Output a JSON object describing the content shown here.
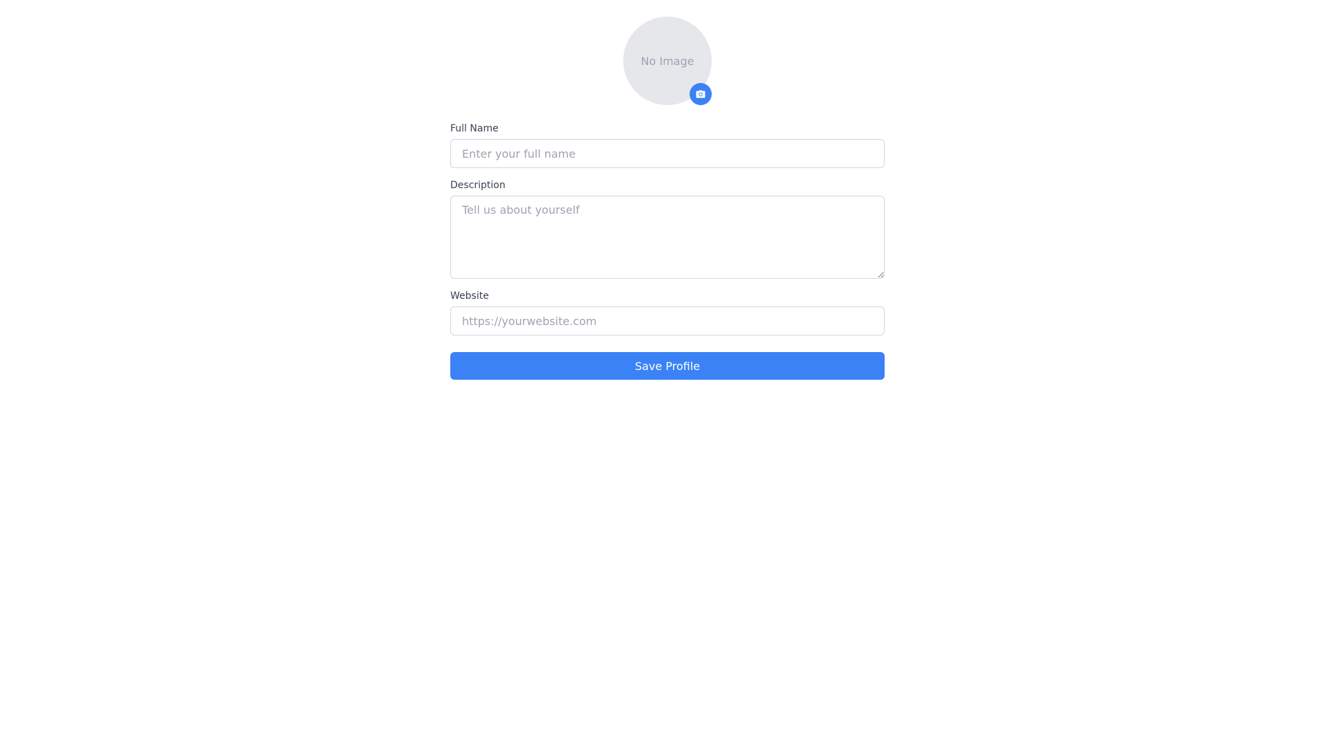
{
  "avatar": {
    "placeholder_text": "No Image",
    "upload_icon": "camera-icon"
  },
  "form": {
    "full_name": {
      "label": "Full Name",
      "placeholder": "Enter your full name",
      "value": ""
    },
    "description": {
      "label": "Description",
      "placeholder": "Tell us about yourself",
      "value": ""
    },
    "website": {
      "label": "Website",
      "placeholder": "https://yourwebsite.com",
      "value": ""
    },
    "submit_label": "Save Profile"
  },
  "colors": {
    "accent": "#3b82f6",
    "avatar_bg": "#e5e7eb",
    "placeholder": "#9ca3af",
    "label": "#374151",
    "border": "#d1d5db"
  }
}
